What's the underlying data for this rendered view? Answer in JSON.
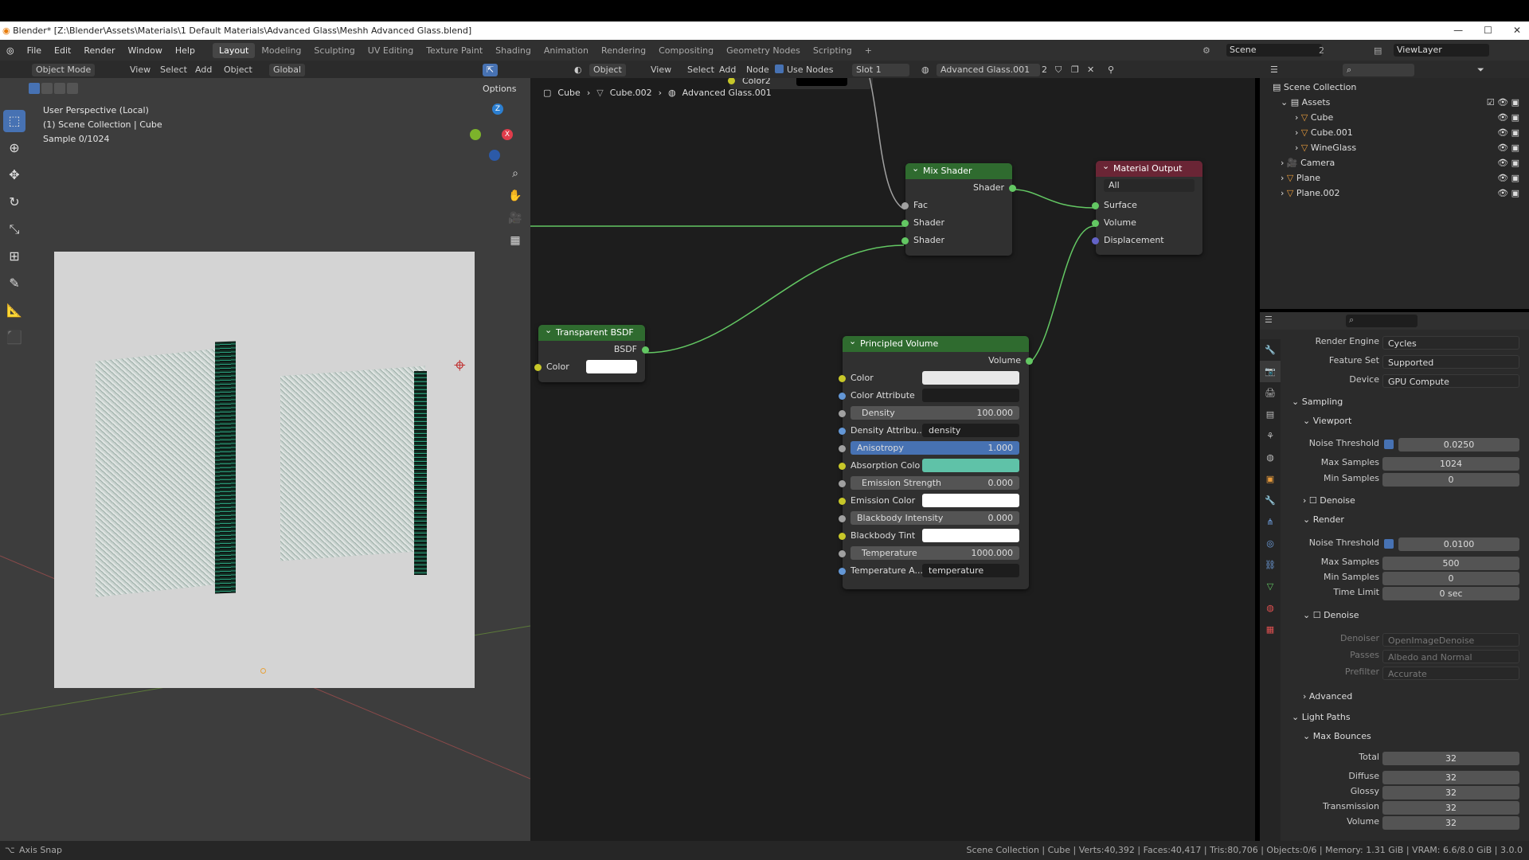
{
  "window": {
    "title": "Blender* [Z:\\Blender\\Assets\\Materials\\1 Default Materials\\Advanced Glass\\Meshh Advanced Glass.blend]"
  },
  "menu": {
    "items": [
      "File",
      "Edit",
      "Render",
      "Window",
      "Help"
    ],
    "tabs": [
      "Layout",
      "Modeling",
      "Sculpting",
      "UV Editing",
      "Texture Paint",
      "Shading",
      "Animation",
      "Rendering",
      "Compositing",
      "Geometry Nodes",
      "Scripting"
    ],
    "active_tab": "Layout"
  },
  "scene": {
    "name": "Scene",
    "count": "2",
    "view_layer": "ViewLayer"
  },
  "viewport": {
    "mode": "Object Mode",
    "menus": [
      "View",
      "Select",
      "Add",
      "Object"
    ],
    "orientation": "Global",
    "options": "Options",
    "info_line1": "User Perspective (Local)",
    "info_line2": "(1) Scene Collection | Cube",
    "info_line3": "Sample 0/1024"
  },
  "node_editor": {
    "type": "Object",
    "menus": [
      "View",
      "Select",
      "Add",
      "Node"
    ],
    "use_nodes": "Use Nodes",
    "slot": "Slot 1",
    "material": "Advanced Glass.001",
    "users": "2",
    "breadcrumb": [
      "Cube",
      "Cube.002",
      "Advanced Glass.001"
    ],
    "color2_label": "Color2"
  },
  "nodes": {
    "mix_shader": {
      "title": "Mix Shader",
      "out": "Shader",
      "inputs": [
        "Fac",
        "Shader",
        "Shader"
      ]
    },
    "material_output": {
      "title": "Material Output",
      "target": "All",
      "inputs": [
        "Surface",
        "Volume",
        "Displacement"
      ]
    },
    "transparent": {
      "title": "Transparent BSDF",
      "out": "BSDF",
      "color_label": "Color"
    },
    "principled_volume": {
      "title": "Principled Volume",
      "out": "Volume",
      "color": "Color",
      "color_attr": "Color Attribute",
      "density_label": "Density",
      "density": "100.000",
      "density_attr_label": "Density Attribu...",
      "density_attr": "density",
      "anisotropy_label": "Anisotropy",
      "anisotropy": "1.000",
      "absorption": "Absorption Colo",
      "emission_strength_label": "Emission Strength",
      "emission_strength": "0.000",
      "emission_color": "Emission Color",
      "blackbody_label": "Blackbody Intensity",
      "blackbody": "0.000",
      "blackbody_tint": "Blackbody Tint",
      "temperature_label": "Temperature",
      "temperature": "1000.000",
      "temp_attr_label": "Temperature A...",
      "temp_attr": "temperature"
    }
  },
  "outliner": {
    "root": "Scene Collection",
    "items": [
      "Assets",
      "Cube",
      "Cube.001",
      "WineGlass",
      "Camera",
      "Plane",
      "Plane.002"
    ]
  },
  "properties": {
    "render_engine_label": "Render Engine",
    "render_engine": "Cycles",
    "feature_set_label": "Feature Set",
    "feature_set": "Supported",
    "device_label": "Device",
    "device": "GPU Compute",
    "sampling": "Sampling",
    "viewport": "Viewport",
    "noise_threshold": "Noise Threshold",
    "vp_noise": "0.0250",
    "max_samples": "Max Samples",
    "vp_max": "1024",
    "min_samples": "Min Samples",
    "vp_min": "0",
    "denoise": "Denoise",
    "render": "Render",
    "r_noise": "0.0100",
    "r_max": "500",
    "r_min": "0",
    "time_limit": "Time Limit",
    "r_time": "0 sec",
    "denoiser_label": "Denoiser",
    "denoiser": "OpenImageDenoise",
    "passes_label": "Passes",
    "passes": "Albedo and Normal",
    "prefilter_label": "Prefilter",
    "prefilter": "Accurate",
    "advanced": "Advanced",
    "light_paths": "Light Paths",
    "max_bounces": "Max Bounces",
    "total": "Total",
    "total_v": "32",
    "diffuse": "Diffuse",
    "diffuse_v": "32",
    "glossy": "Glossy",
    "glossy_v": "32",
    "transmission": "Transmission",
    "transmission_v": "32",
    "volume": "Volume",
    "volume_v": "32"
  },
  "status": {
    "left": "Axis Snap",
    "right": "Scene Collection | Cube | Verts:40,392 | Faces:40,417 | Tris:80,706 | Objects:0/6 | Memory: 1.31 GiB | VRAM: 6.6/8.0 GiB | 3.0.0"
  }
}
